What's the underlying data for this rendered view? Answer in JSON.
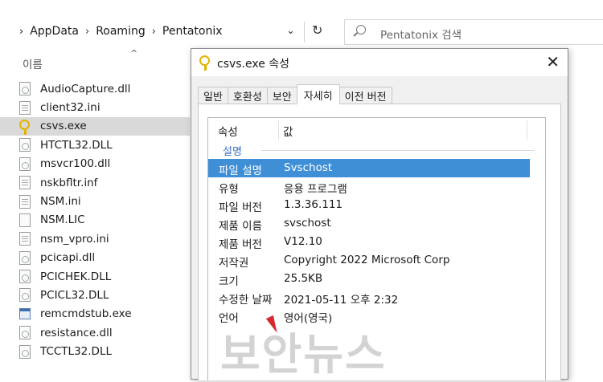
{
  "address_bar": {
    "lead_chevron": "›",
    "crumbs": [
      "AppData",
      "Roaming",
      "Pentatonix"
    ],
    "separator": "›",
    "dropdown_glyph": "⌄",
    "refresh_glyph": "↻",
    "search_placeholder": "Pentatonix 검색"
  },
  "file_list": {
    "column_header": "이름",
    "sort_glyph": "^",
    "files": [
      {
        "name": "AudioCapture.dll",
        "icon": "dll-file-icon"
      },
      {
        "name": "client32.ini",
        "icon": "ini-file-icon"
      },
      {
        "name": "csvs.exe",
        "icon": "key-exe-icon",
        "selected": true
      },
      {
        "name": "HTCTL32.DLL",
        "icon": "dll-file-icon"
      },
      {
        "name": "msvcr100.dll",
        "icon": "dll-file-icon"
      },
      {
        "name": "nskbfltr.inf",
        "icon": "ini-file-icon"
      },
      {
        "name": "NSM.ini",
        "icon": "ini-file-icon"
      },
      {
        "name": "NSM.LIC",
        "icon": "blank-file-icon"
      },
      {
        "name": "nsm_vpro.ini",
        "icon": "ini-file-icon"
      },
      {
        "name": "pcicapi.dll",
        "icon": "dll-file-icon"
      },
      {
        "name": "PCICHEK.DLL",
        "icon": "dll-file-icon"
      },
      {
        "name": "PCICL32.DLL",
        "icon": "dll-file-icon"
      },
      {
        "name": "remcmdstub.exe",
        "icon": "app-exe-icon"
      },
      {
        "name": "resistance.dll",
        "icon": "dll-file-icon"
      },
      {
        "name": "TCCTL32.DLL",
        "icon": "dll-file-icon"
      }
    ]
  },
  "dialog": {
    "title": "csvs.exe 속성",
    "close_glyph": "✕",
    "tabs": [
      {
        "label": "일반",
        "active": false
      },
      {
        "label": "호환성",
        "active": false
      },
      {
        "label": "보안",
        "active": false
      },
      {
        "label": "자세히",
        "active": true
      },
      {
        "label": "이전 버전",
        "active": false
      }
    ],
    "table_header": {
      "property": "속성",
      "value": "값"
    },
    "group_label": "설명",
    "rows": [
      {
        "key": "파일 설명",
        "value": "Svschost",
        "selected": true
      },
      {
        "key": "유형",
        "value": "응용 프로그램"
      },
      {
        "key": "파일 버전",
        "value": "1.3.36.111"
      },
      {
        "key": "제품 이름",
        "value": "svschost"
      },
      {
        "key": "제품 버전",
        "value": "V12.10"
      },
      {
        "key": "저작권",
        "value": "Copyright 2022 Microsoft Corp"
      },
      {
        "key": "크기",
        "value": "25.5KB"
      },
      {
        "key": "수정한 날짜",
        "value": "2021-05-11 오후 2:32"
      },
      {
        "key": "언어",
        "value": "영어(영국)"
      }
    ]
  },
  "watermark": "보안뉴스",
  "colors": {
    "selection": "#3f8fd6",
    "group_label": "#3a6fc0",
    "file_selected": "#d9d9d9",
    "watermark_mark": "#d8282f"
  }
}
